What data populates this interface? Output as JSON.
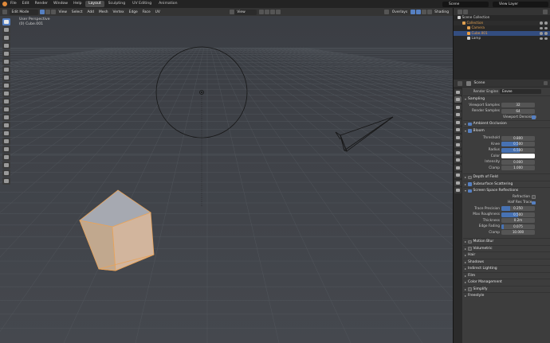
{
  "topbar": {
    "menu": [
      "File",
      "Edit",
      "Render",
      "Window",
      "Help"
    ],
    "workspaces": [
      "Layout",
      "Sculpting",
      "UV Editing",
      "Animation"
    ],
    "active_workspace": "Layout",
    "scene": "Scene",
    "view_layer": "View Layer"
  },
  "viewport_header": {
    "mode": "Edit Mode",
    "menus": [
      "View",
      "Select",
      "Add",
      "Mesh",
      "Vertex",
      "Edge",
      "Face",
      "UV"
    ],
    "transform_orientation": "View",
    "overlays": "Overlays",
    "shading": "Shading"
  },
  "viewport": {
    "perspective": "User Perspective",
    "object": "(0) Cube.001"
  },
  "outliner": {
    "items": [
      {
        "label": "Scene Collection",
        "indent": 0,
        "color": "#d0d0d0"
      },
      {
        "label": "Collection",
        "indent": 1,
        "color": "#e0a050"
      },
      {
        "label": "Camera",
        "indent": 2,
        "color": "#e0a050"
      },
      {
        "label": "Cube.001",
        "indent": 2,
        "color": "#f0a040",
        "selected": true
      },
      {
        "label": "Lamp",
        "indent": 2,
        "color": "#d0d0d0"
      }
    ]
  },
  "properties": {
    "context": "Scene",
    "render_engine_label": "Render Engine",
    "render_engine": "Eevee",
    "sampling": {
      "title": "Sampling",
      "viewport_samples_label": "Viewport Samples",
      "viewport_samples": "32",
      "render_samples_label": "Render Samples",
      "render_samples": "64",
      "viewport_denoising": "Viewport Denoising"
    },
    "ambient_occlusion": "Ambient Occlusion",
    "bloom": {
      "title": "Bloom",
      "fields": [
        {
          "label": "Threshold",
          "value": "0.800"
        },
        {
          "label": "Knee",
          "value": "0.500",
          "fill": 0.5
        },
        {
          "label": "Radius",
          "value": "6.500",
          "fill": 0.55
        },
        {
          "label": "Color",
          "value": "",
          "swatch": "#ffffff"
        },
        {
          "label": "Intensity",
          "value": "0.000"
        },
        {
          "label": "Clamp",
          "value": "1.000"
        }
      ]
    },
    "depth_of_field": "Depth of Field",
    "subsurface_scattering": "Subsurface Scattering",
    "ssr": {
      "title": "Screen Space Reflections",
      "refraction": "Refraction",
      "half_res_trace": "Half Res Trace",
      "fields": [
        {
          "label": "Trace Precision",
          "value": "0.250",
          "fill": 0.25
        },
        {
          "label": "Max Roughness",
          "value": "0.500",
          "fill": 0.5
        },
        {
          "label": "Thickness",
          "value": "0.2m"
        },
        {
          "label": "Edge Fading",
          "value": "0.075",
          "fill": 0.08
        },
        {
          "label": "Clamp",
          "value": "10.000"
        }
      ]
    },
    "collapsed_panels": [
      "Motion Blur",
      "Volumetric",
      "Hair",
      "Shadows",
      "Indirect Lighting",
      "Film",
      "Color Management",
      "Simplify",
      "Freestyle"
    ]
  }
}
